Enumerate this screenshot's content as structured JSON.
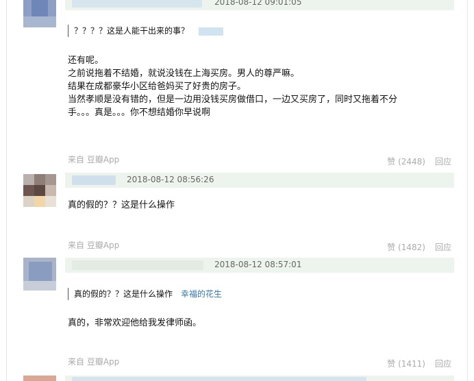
{
  "comments": [
    {
      "time": "2018-08-12 09:01:05",
      "quote_text": "？？？？这是人能干出来的事？",
      "body": [
        "还有呢。",
        "之前说拖着不结婚，就说没钱在上海买房。男人的尊严嘛。",
        "结果在成都豪华小区给爸妈买了好贵的房子。",
        "当然孝顺是没有错的，但是一边用没钱买房做借口，一边又买房了，同时又拖着不分",
        "手。。。真是。。。你不想结婚你早说啊"
      ],
      "source_prefix": "来自",
      "source_app": "豆瓣App",
      "like_label": "赞 (2448)",
      "reply_label": "回应"
    },
    {
      "time": "2018-08-12 08:56:26",
      "body": [
        "真的假的？？这是什么操作"
      ],
      "source_prefix": "来自",
      "source_app": "豆瓣App",
      "like_label": "赞 (1482)",
      "reply_label": "回应"
    },
    {
      "time": "2018-08-12 08:57:01",
      "quote_text": "真的假的？？这是什么操作",
      "quote_author": "幸福的花生",
      "body": [
        "真的，非常欢迎他给我发律师函。"
      ],
      "source_prefix": "来自",
      "source_app": "豆瓣App",
      "like_label": "赞 (1411)",
      "reply_label": "回应"
    }
  ]
}
